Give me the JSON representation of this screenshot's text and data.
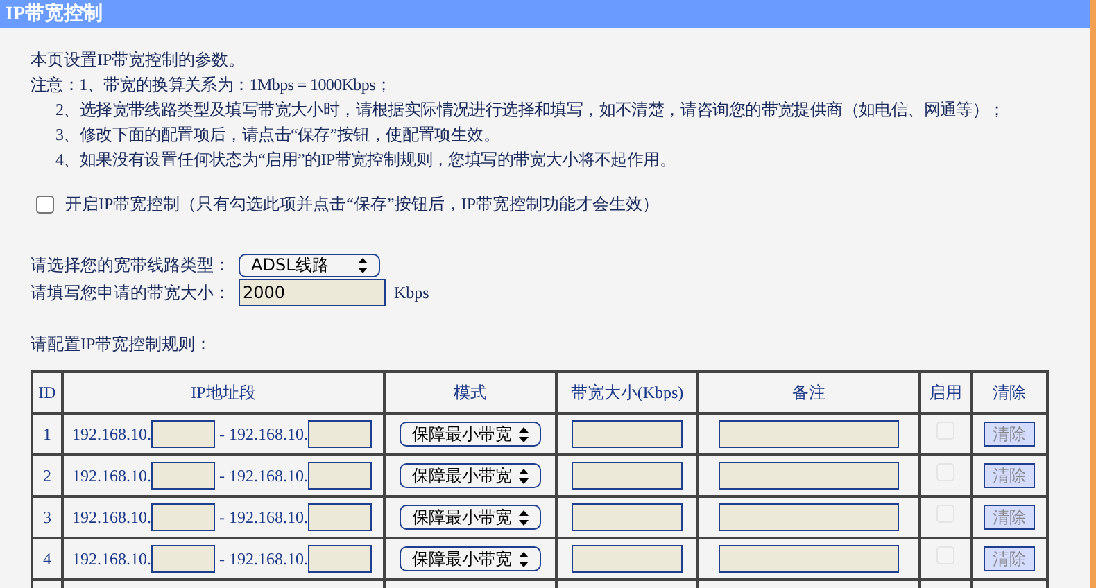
{
  "header": {
    "title": "IP带宽控制"
  },
  "intro": "本页设置IP带宽控制的参数。",
  "notes": [
    {
      "prefix": "注意：",
      "text": "1、带宽的换算关系为：1Mbps = 1000Kbps；"
    },
    {
      "text": "2、选择宽带线路类型及填写带宽大小时，请根据实际情况进行选择和填写，如不清楚，请咨询您的带宽提供商（如电信、网通等）；"
    },
    {
      "text": "3、修改下面的配置项后，请点击“保存”按钮，使配置项生效。"
    },
    {
      "text": "4、如果没有设置任何状态为“启用”的IP带宽控制规则，您填写的带宽大小将不起作用。"
    }
  ],
  "enable_control": {
    "label": "开启IP带宽控制（只有勾选此项并点击“保存”按钮后，IP带宽控制功能才会生效）",
    "checked": false
  },
  "line_type": {
    "label": "请选择您的宽带线路类型：",
    "value": "ADSL线路"
  },
  "bandwidth": {
    "label": "请填写您申请的带宽大小：",
    "value": "2000",
    "unit": "Kbps"
  },
  "rules_title": "请配置IP带宽控制规则：",
  "table": {
    "columns": [
      "ID",
      "IP地址段",
      "模式",
      "带宽大小(Kbps)",
      "备注",
      "启用",
      "清除"
    ],
    "rows": [
      {
        "id": "1",
        "ip_prefix_start": "192.168.10.",
        "separator": "-",
        "ip_prefix_end": "192.168.10.",
        "mode": "保障最小带宽",
        "enabled": false,
        "disabled": true,
        "clear": "清除"
      },
      {
        "id": "2",
        "ip_prefix_start": "192.168.10.",
        "separator": "-",
        "ip_prefix_end": "192.168.10.",
        "mode": "保障最小带宽",
        "enabled": false,
        "disabled": true,
        "clear": "清除"
      },
      {
        "id": "3",
        "ip_prefix_start": "192.168.10.",
        "separator": "-",
        "ip_prefix_end": "192.168.10.",
        "mode": "保障最小带宽",
        "enabled": false,
        "disabled": true,
        "clear": "清除"
      },
      {
        "id": "4",
        "ip_prefix_start": "192.168.10.",
        "separator": "-",
        "ip_prefix_end": "192.168.10.",
        "mode": "保障最小带宽",
        "enabled": false,
        "disabled": true,
        "clear": "清除"
      }
    ]
  }
}
